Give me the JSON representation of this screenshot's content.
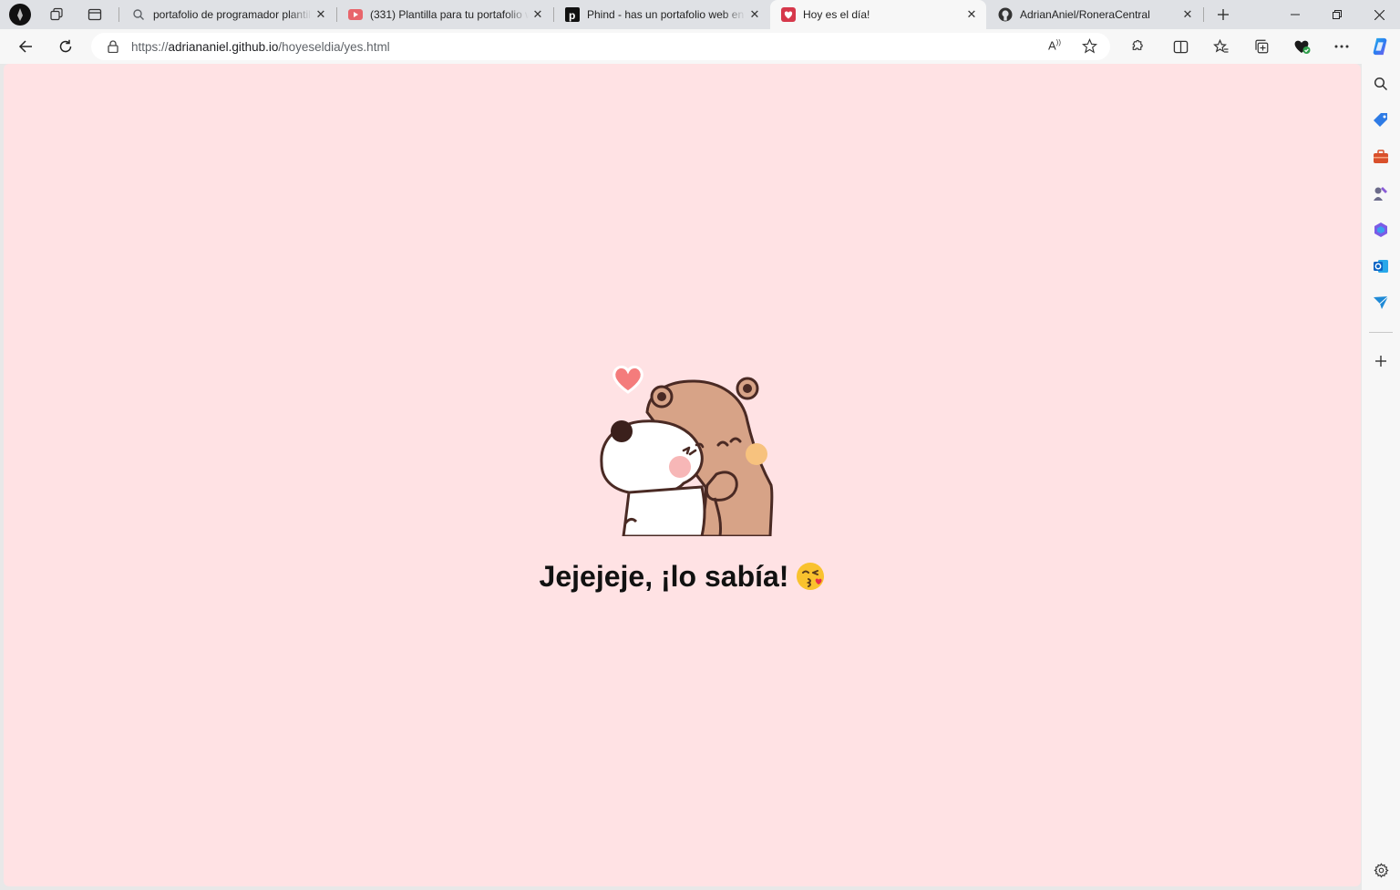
{
  "tabs": [
    {
      "title": "portafolio de programador plantilla",
      "icon": "search-icon"
    },
    {
      "title": "(331) Plantilla para tu portafolio web",
      "icon": "youtube-icon"
    },
    {
      "title": "Phind - has un portafolio web en",
      "icon": "phind-icon"
    },
    {
      "title": "Hoy es el día!",
      "icon": "heart-favicon",
      "active": true
    },
    {
      "title": "AdrianAniel/RoneraCentral",
      "icon": "github-icon"
    }
  ],
  "address": {
    "scheme": "https://",
    "host": "adriananiel.github.io",
    "path": "/hoyeseldia/yes.html"
  },
  "page": {
    "message": "Jejejeje, ¡lo sabía!",
    "emoji": "face-blowing-kiss"
  },
  "colors": {
    "page_background": "#ffe2e4",
    "heart": "#f47c7c"
  }
}
